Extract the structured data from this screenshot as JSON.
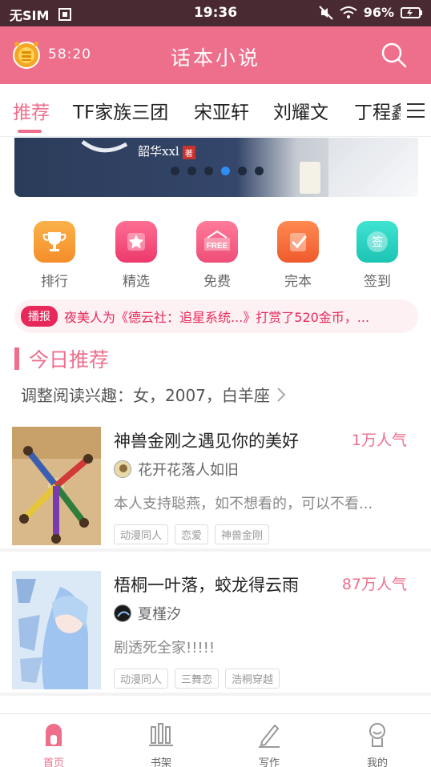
{
  "statusbar": {
    "carrier": "无SIM",
    "time": "19:36",
    "battery": "96%"
  },
  "header": {
    "timer": "58:20",
    "title": "话本小说"
  },
  "tabs": [
    "推荐",
    "TF家族三团",
    "宋亚轩",
    "刘耀文",
    "丁程鑫"
  ],
  "banner": {
    "author": "韶华xxl",
    "author_tag": "著",
    "dots": 6,
    "active_dot": 4
  },
  "shortcuts": [
    {
      "label": "排行",
      "icon": "trophy-icon",
      "color": "#f7a23a"
    },
    {
      "label": "精选",
      "icon": "star-icon",
      "color": "#f04f7d"
    },
    {
      "label": "免费",
      "icon": "free-icon",
      "color": "#f0577a"
    },
    {
      "label": "完本",
      "icon": "check-icon",
      "color": "#f46a3f"
    },
    {
      "label": "签到",
      "icon": "signin-icon",
      "color": "#26d1c1"
    }
  ],
  "notice": {
    "badge": "播报",
    "text": "夜美人为《德云社：追星系统...》打赏了520金币，..."
  },
  "section": {
    "title": "今日推荐",
    "interest": "调整阅读兴趣：女，2007，白羊座"
  },
  "books": [
    {
      "title": "神兽金刚之遇见你的美好",
      "popularity": "1万人气",
      "author": "花开花落人如旧",
      "desc": "本人支持聪燕，如不想看的，可以不看...",
      "tags": [
        "动漫同人",
        "恋爱",
        "神兽金刚"
      ]
    },
    {
      "title": "梧桐一叶落，蛟龙得云雨",
      "popularity": "87万人气",
      "author": "夏槿汐",
      "desc": "剧透死全家!!!!!",
      "tags": [
        "动漫同人",
        "三舞恋",
        "浩桐穿越"
      ]
    }
  ],
  "bottomnav": [
    "首页",
    "书架",
    "写作",
    "我的"
  ],
  "colors": {
    "accent": "#ee6f8c",
    "statusbar": "#4a2a32",
    "notice_red": "#e8285a"
  }
}
